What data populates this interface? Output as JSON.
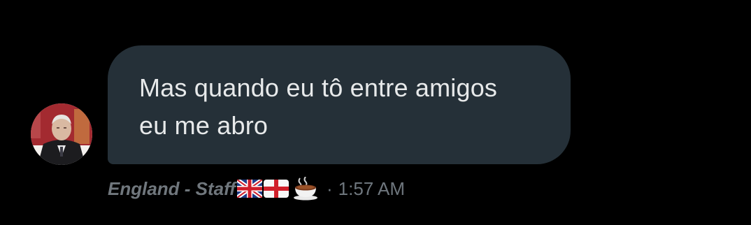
{
  "message": {
    "lines": [
      "Mas quando eu tô entre amigos",
      "eu me abro"
    ]
  },
  "meta": {
    "sender_name": "England - Staff",
    "sender_emoji": [
      "uk-flag-icon",
      "england-flag-icon",
      "tea-cup-icon"
    ],
    "separator": "·",
    "time": "1:57 AM"
  },
  "colors": {
    "background": "#000000",
    "bubble": "#253038",
    "message_text": "#e7e9ea",
    "meta_text": "#6e767d"
  }
}
